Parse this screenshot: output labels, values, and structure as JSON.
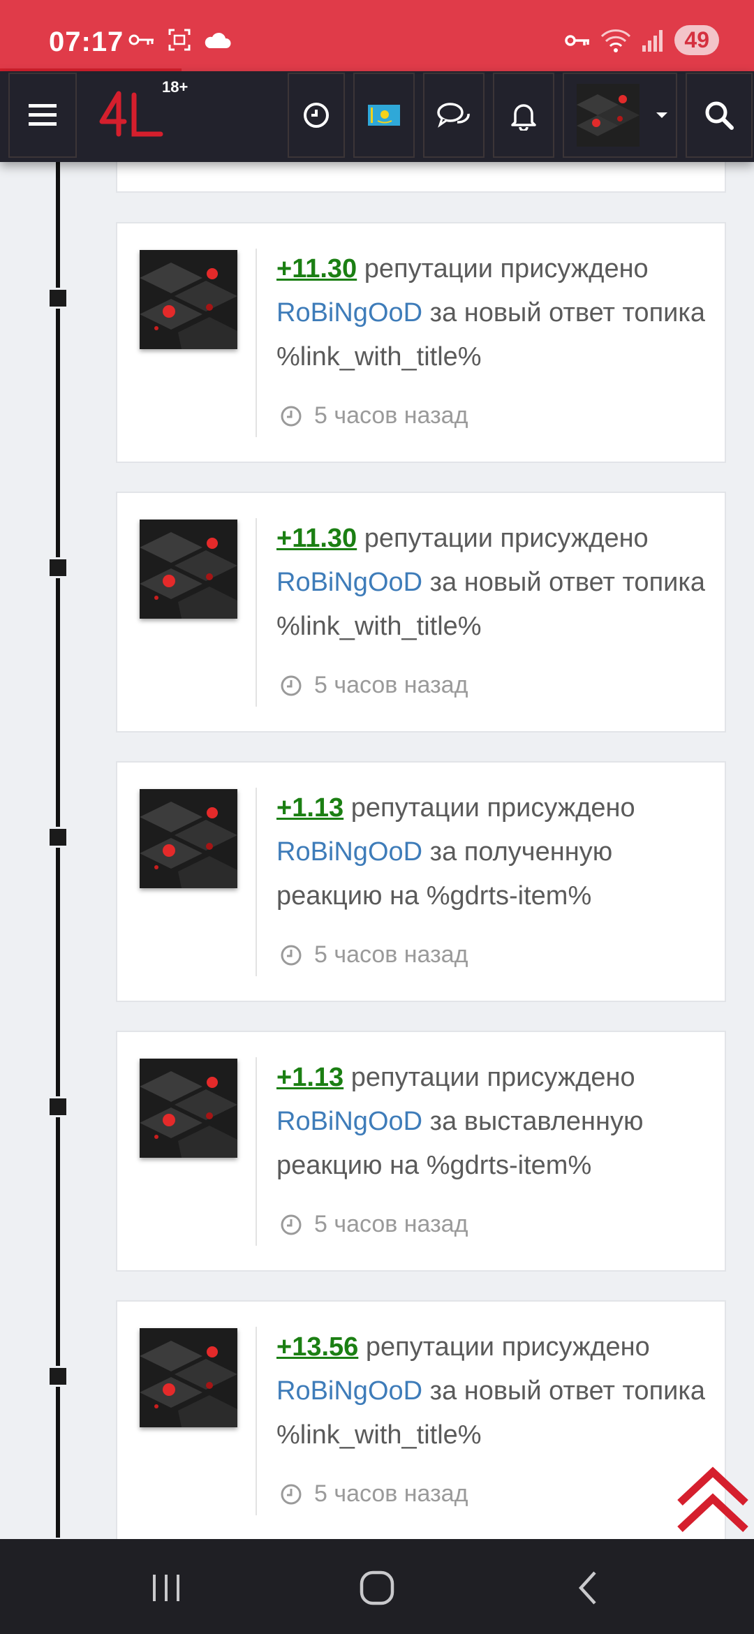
{
  "status_bar": {
    "time": "07:17",
    "battery": "49",
    "icons_left": [
      "key-icon",
      "screenshot-icon",
      "cloud-icon"
    ],
    "icons_right": [
      "vpn-key-icon",
      "wifi-icon",
      "signal-icon"
    ]
  },
  "header": {
    "logo_text": "4L",
    "age_badge": "18+",
    "icons": [
      "menu-icon",
      "clock-icon",
      "flag-kazakhstan-icon",
      "chat-icon",
      "bell-icon",
      "avatar",
      "search-icon"
    ]
  },
  "feed": [
    {
      "points": "+11.30",
      "prefix": "репутации присуждено",
      "user": "RoBiNgOoD",
      "suffix": "за новый ответ топика %link_with_title%",
      "time": "5 часов назад"
    },
    {
      "points": "+11.30",
      "prefix": "репутации присуждено",
      "user": "RoBiNgOoD",
      "suffix": "за новый ответ топика %link_with_title%",
      "time": "5 часов назад"
    },
    {
      "points": "+1.13",
      "prefix": "репутации присуждено",
      "user": "RoBiNgOoD",
      "suffix": "за полученную реакцию на %gdrts-item%",
      "time": "5 часов назад"
    },
    {
      "points": "+1.13",
      "prefix": "репутации присуждено",
      "user": "RoBiNgOoD",
      "suffix": "за выставленную реакцию на %gdrts-item%",
      "time": "5 часов назад"
    },
    {
      "points": "+13.56",
      "prefix": "репутации присуждено",
      "user": "RoBiNgOoD",
      "suffix": "за новый ответ топика %link_with_title%",
      "time": "5 часов назад"
    }
  ],
  "colors": {
    "status_bar": "#e03b49",
    "header": "#22222c",
    "points": "#1b7f13",
    "user_link": "#3e7cb9",
    "accent_red": "#d11f2c"
  },
  "navbar": {
    "icons": [
      "recents-icon",
      "home-icon",
      "back-icon"
    ]
  }
}
